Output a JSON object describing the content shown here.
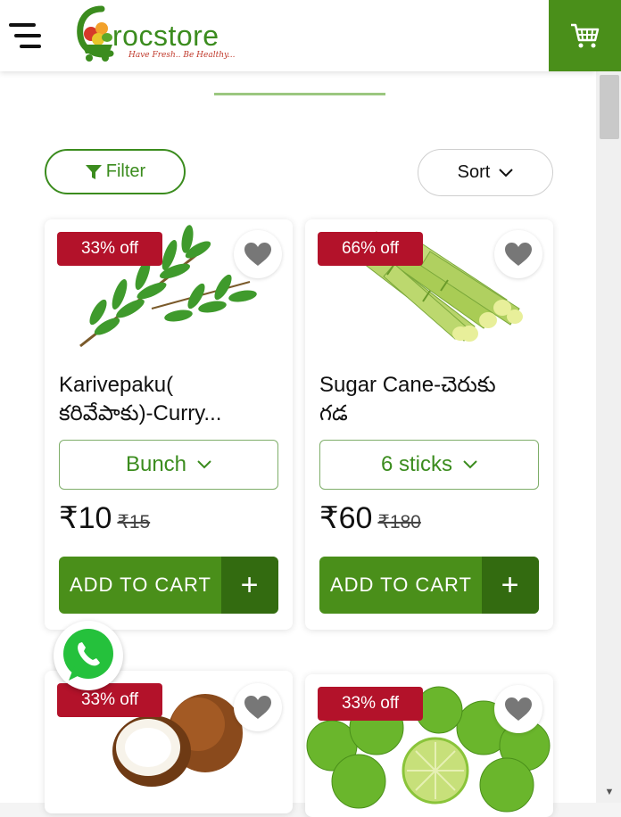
{
  "header": {
    "brand": "rocstore",
    "tagline": "Have Fresh.. Be Healthy..."
  },
  "toolbar": {
    "filter_label": "Filter",
    "sort_label": "Sort"
  },
  "products": [
    {
      "badge": "33% off",
      "name": "Karivepaku(\nకరివేపాకు)-Curry...",
      "variant": "Bunch",
      "price": "₹10",
      "mrp": "₹15",
      "add_label": "ADD TO CART",
      "plus": "+"
    },
    {
      "badge": "66% off",
      "name": "Sugar Cane-చెరుకు\nగడ",
      "variant": "6 sticks",
      "price": "₹60",
      "mrp": "₹180",
      "add_label": "ADD TO CART",
      "plus": "+"
    },
    {
      "badge": "33% off"
    },
    {
      "badge": "33% off"
    }
  ],
  "colors": {
    "brand_green": "#4a8f1a",
    "badge_red": "#b3122a"
  },
  "icons": [
    "menu-icon",
    "cart-icon",
    "filter-icon",
    "chevron-down-icon",
    "heart-icon",
    "plus-icon",
    "whatsapp-icon"
  ]
}
